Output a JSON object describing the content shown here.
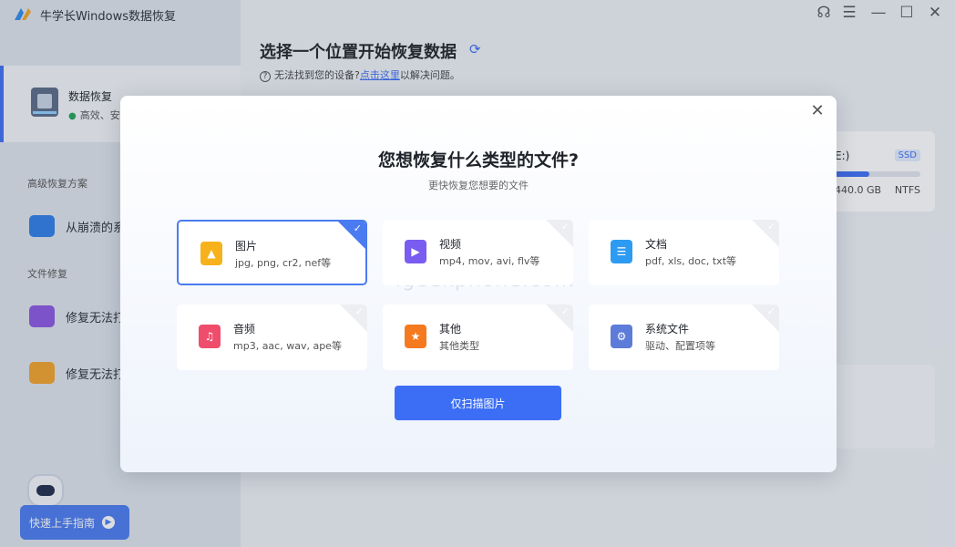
{
  "app": {
    "title": "牛学长Windows数据恢复"
  },
  "sidebar": {
    "main_item": {
      "label": "数据恢复",
      "sub": "高效、安"
    },
    "section_advanced": "高级恢复方案",
    "crash_item": "从崩溃的系",
    "section_repair": "文件修复",
    "repair_items": [
      "修复无法打",
      "修复无法打"
    ],
    "guide_button": "快速上手指南"
  },
  "main": {
    "title": "选择一个位置开始恢复数据",
    "help_prefix": "无法找到您的设备?",
    "help_link": "点击这里",
    "help_suffix": "以解决问题。"
  },
  "drive": {
    "name": "E:)",
    "type_badge": "SSD",
    "size": "440.0 GB",
    "fs": "NTFS",
    "used_fraction": 0.4
  },
  "dialog": {
    "title": "您想恢复什么类型的文件?",
    "subtitle": "更快恢复您想要的文件",
    "file_types": [
      {
        "name": "图片",
        "desc": "jpg, png, cr2, nef等",
        "icon": "image-file-icon",
        "color": "#f7b21b",
        "glyph": "▲",
        "selected": true
      },
      {
        "name": "视频",
        "desc": "mp4, mov, avi, flv等",
        "icon": "video-file-icon",
        "color": "#7b5cf0",
        "glyph": "▶",
        "selected": false
      },
      {
        "name": "文档",
        "desc": "pdf, xls, doc, txt等",
        "icon": "document-file-icon",
        "color": "#2e9bf2",
        "glyph": "☰",
        "selected": false
      },
      {
        "name": "音频",
        "desc": "mp3, aac, wav, ape等",
        "icon": "audio-file-icon",
        "color": "#f04c6b",
        "glyph": "♫",
        "selected": false
      },
      {
        "name": "其他",
        "desc": "其他类型",
        "icon": "other-file-icon",
        "color": "#f57a1f",
        "glyph": "★",
        "selected": false
      },
      {
        "name": "系统文件",
        "desc": "驱动、配置项等",
        "icon": "system-file-icon",
        "color": "#5d7bd8",
        "glyph": "⚙",
        "selected": false
      }
    ],
    "scan_button": "仅扫描图片",
    "watermark": "igeekphone.com"
  }
}
